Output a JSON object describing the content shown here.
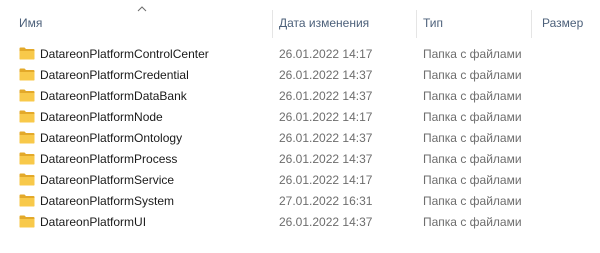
{
  "colors": {
    "header_text": "#4c607a",
    "name_text": "#1a1a1a",
    "detail_text": "#6d6d6d",
    "separator": "#e5e5e5",
    "folder_body": "#f8c94a",
    "folder_tab": "#e3a92a"
  },
  "header": {
    "name_label": "Имя",
    "date_label": "Дата изменения",
    "type_label": "Тип",
    "size_label": "Размер",
    "sort_indicator": "chevron-up-icon"
  },
  "files": [
    {
      "icon": "folder-icon",
      "name": "DatareonPlatformControlCenter",
      "date": "26.01.2022 14:17",
      "type": "Папка с файлами"
    },
    {
      "icon": "folder-icon",
      "name": "DatareonPlatformCredential",
      "date": "26.01.2022 14:37",
      "type": "Папка с файлами"
    },
    {
      "icon": "folder-icon",
      "name": "DatareonPlatformDataBank",
      "date": "26.01.2022 14:37",
      "type": "Папка с файлами"
    },
    {
      "icon": "folder-icon",
      "name": "DatareonPlatformNode",
      "date": "26.01.2022 14:17",
      "type": "Папка с файлами"
    },
    {
      "icon": "folder-icon",
      "name": "DatareonPlatformOntology",
      "date": "26.01.2022 14:37",
      "type": "Папка с файлами"
    },
    {
      "icon": "folder-icon",
      "name": "DatareonPlatformProcess",
      "date": "26.01.2022 14:37",
      "type": "Папка с файлами"
    },
    {
      "icon": "folder-icon",
      "name": "DatareonPlatformService",
      "date": "26.01.2022 14:17",
      "type": "Папка с файлами"
    },
    {
      "icon": "folder-icon",
      "name": "DatareonPlatformSystem",
      "date": "27.01.2022 16:31",
      "type": "Папка с файлами"
    },
    {
      "icon": "folder-icon",
      "name": "DatareonPlatformUI",
      "date": "26.01.2022 14:37",
      "type": "Папка с файлами"
    }
  ]
}
